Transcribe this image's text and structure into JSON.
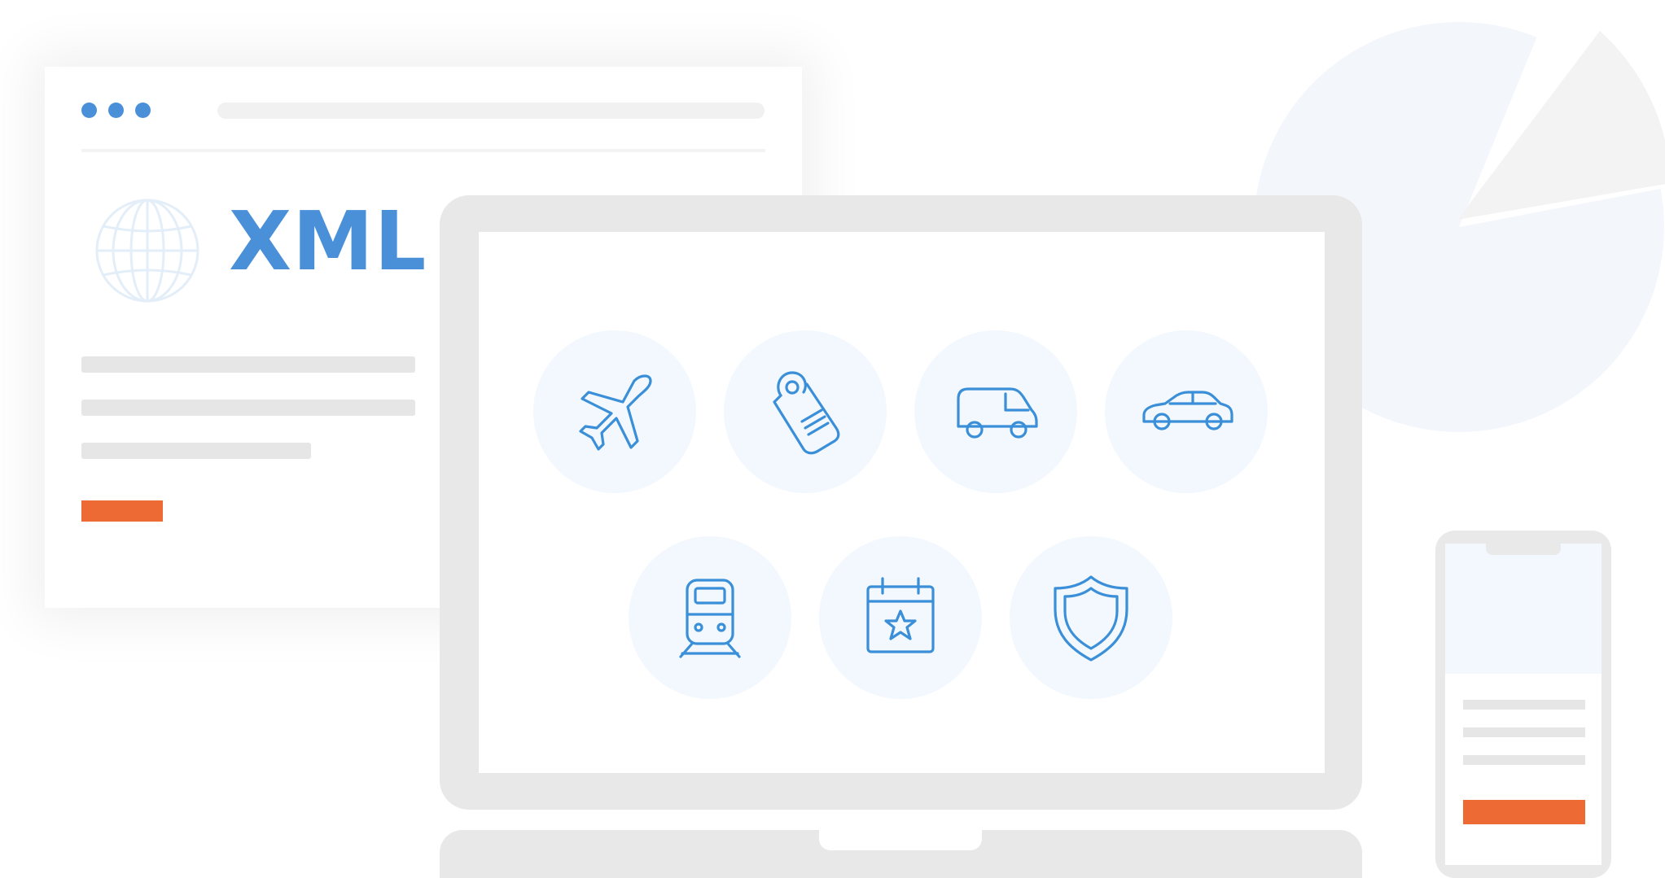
{
  "colors": {
    "accent_blue": "#3a8fd8",
    "dot_blue": "#4a90d9",
    "cta_orange": "#ee6a35",
    "light_blue_bg": "#f2f8fd",
    "device_gray": "#e8e8e8"
  },
  "xml_card": {
    "title": "XML",
    "icon": "globe-icon"
  },
  "services": [
    {
      "name": "flights",
      "icon": "airplane-icon"
    },
    {
      "name": "hotels",
      "icon": "door-hanger-icon"
    },
    {
      "name": "transfers",
      "icon": "van-icon"
    },
    {
      "name": "car-rental",
      "icon": "car-icon"
    },
    {
      "name": "rail",
      "icon": "train-icon"
    },
    {
      "name": "events",
      "icon": "calendar-star-icon"
    },
    {
      "name": "insurance",
      "icon": "shield-icon"
    }
  ]
}
